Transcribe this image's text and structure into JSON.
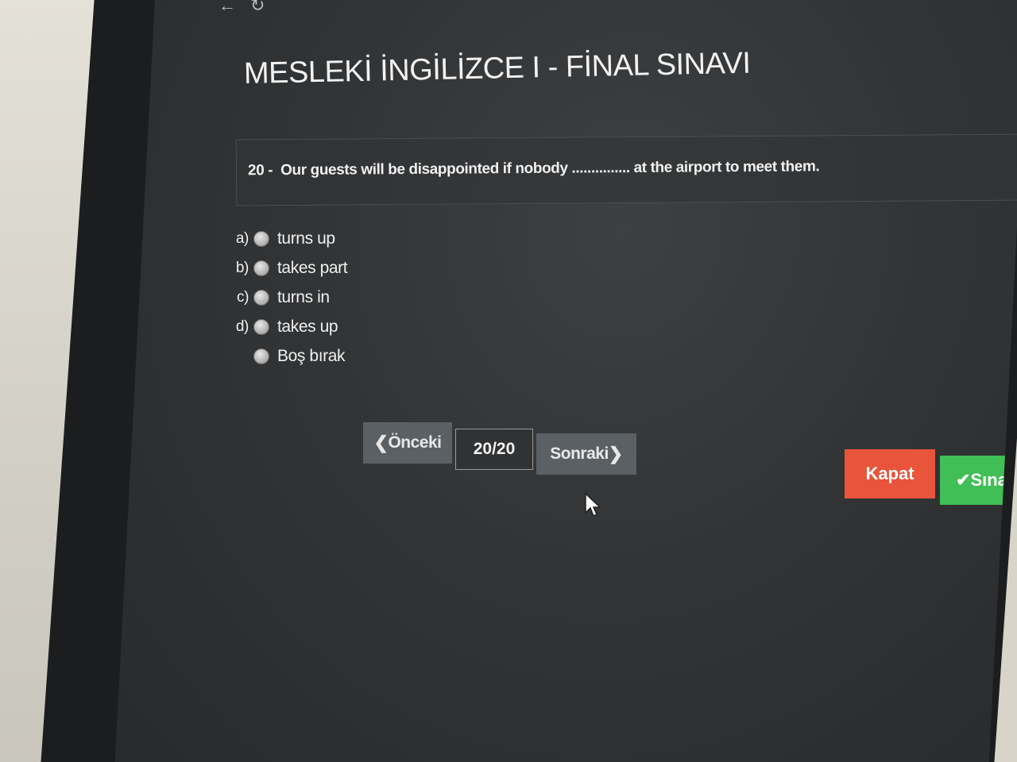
{
  "exam": {
    "title": "MESLEKİ İNGİLİZCE I - FİNAL SINAVI"
  },
  "question": {
    "number": "20 -",
    "text": "Our guests will be disappointed if nobody ............... at the airport to meet them."
  },
  "options": [
    {
      "letter": "a)",
      "text": "turns up"
    },
    {
      "letter": "b)",
      "text": "takes part"
    },
    {
      "letter": "c)",
      "text": "turns in"
    },
    {
      "letter": "d)",
      "text": "takes up"
    },
    {
      "letter": "",
      "text": "Boş bırak"
    }
  ],
  "navigation": {
    "prev_label": "Önceki",
    "counter": "20/20",
    "next_label": "Sonraki"
  },
  "actions": {
    "close_label": "Kapat",
    "finish_label": "Sınav"
  },
  "colors": {
    "close": "#e8553b",
    "finish": "#3fbf55",
    "nav_button": "#5b6064"
  }
}
